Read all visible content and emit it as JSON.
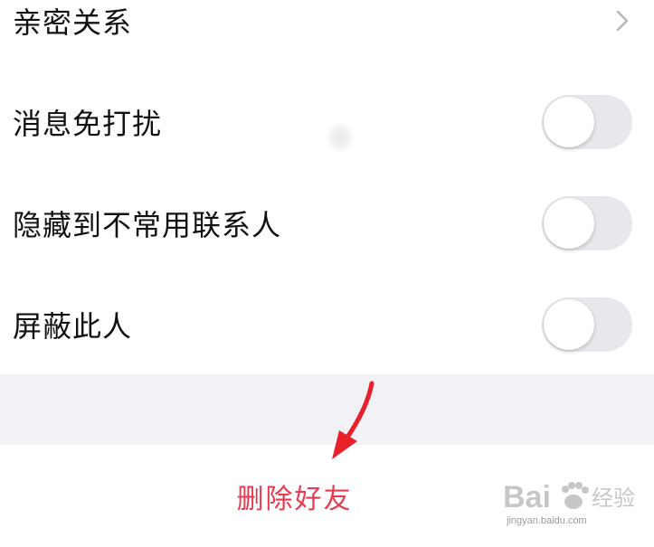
{
  "settings": {
    "intimate_relation": {
      "label": "亲密关系"
    },
    "do_not_disturb": {
      "label": "消息免打扰",
      "enabled": false
    },
    "hide_to_infrequent": {
      "label": "隐藏到不常用联系人",
      "enabled": false
    },
    "block_person": {
      "label": "屏蔽此人",
      "enabled": false
    }
  },
  "actions": {
    "delete_friend": {
      "label": "删除好友",
      "color": "#e83a50"
    }
  },
  "annotation": {
    "arrow_color": "#e8202a"
  },
  "watermark": {
    "brand": "Bai",
    "brand_suffix": "经验",
    "url": "jingyan.baidu.com"
  },
  "colors": {
    "toggle_off": "#e8e8ec",
    "section_gap": "#f2f2f6",
    "chevron": "#b8b8bc"
  }
}
